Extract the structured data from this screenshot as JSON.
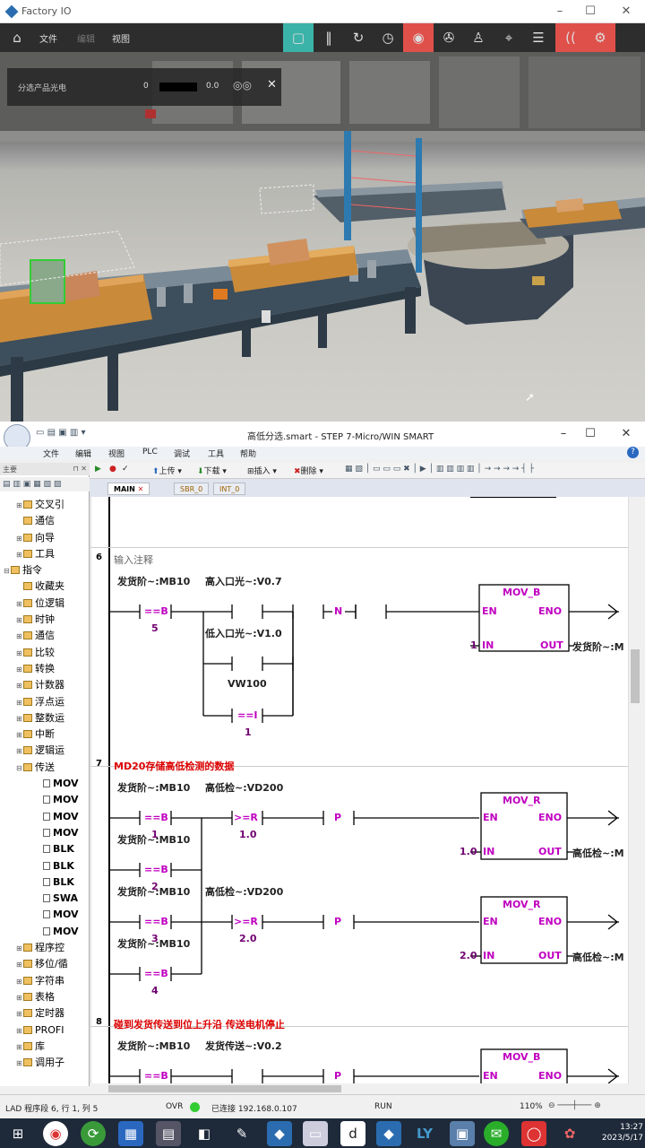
{
  "factoryio": {
    "title": "Factory IO",
    "menu": [
      "文件",
      "编辑",
      "视图"
    ],
    "sensor_panel": {
      "label": "分选产品光电",
      "value_left": "0",
      "value_right": "0.0"
    }
  },
  "step7": {
    "title": "高低分选.smart - STEP 7-Micro/WIN SMART",
    "menu": [
      "文件",
      "编辑",
      "视图",
      "PLC",
      "调试",
      "工具",
      "帮助"
    ],
    "toolbar": {
      "upload": "上传",
      "download": "下载",
      "insert": "插入",
      "delete": "删除"
    },
    "tabs": [
      "MAIN",
      "SBR_0",
      "INT_0"
    ],
    "side_header": "主要",
    "tree": [
      {
        "label": "交叉引",
        "expand": "⊞"
      },
      {
        "label": "通信",
        "expand": ""
      },
      {
        "label": "向导",
        "expand": "⊞"
      },
      {
        "label": "工具",
        "expand": "⊞"
      },
      {
        "label": "指令",
        "expand": "⊟"
      },
      {
        "label": "收藏夹",
        "expand": ""
      },
      {
        "label": "位逻辑",
        "expand": "⊞"
      },
      {
        "label": "时钟",
        "expand": "⊞"
      },
      {
        "label": "通信",
        "expand": "⊞"
      },
      {
        "label": "比较",
        "expand": "⊞"
      },
      {
        "label": "转换",
        "expand": "⊞"
      },
      {
        "label": "计数器",
        "expand": "⊞"
      },
      {
        "label": "浮点运",
        "expand": "⊞"
      },
      {
        "label": "整数运",
        "expand": "⊞"
      },
      {
        "label": "中断",
        "expand": "⊞"
      },
      {
        "label": "逻辑运",
        "expand": "⊞"
      },
      {
        "label": "传送",
        "expand": "⊟"
      },
      {
        "label": "MOV",
        "expand": "leaf"
      },
      {
        "label": "MOV",
        "expand": "leaf"
      },
      {
        "label": "MOV",
        "expand": "leaf"
      },
      {
        "label": "MOV",
        "expand": "leaf"
      },
      {
        "label": "BLK",
        "expand": "leaf"
      },
      {
        "label": "BLK",
        "expand": "leaf"
      },
      {
        "label": "BLK",
        "expand": "leaf"
      },
      {
        "label": "SWA",
        "expand": "leaf"
      },
      {
        "label": "MOV",
        "expand": "leaf"
      },
      {
        "label": "MOV",
        "expand": "leaf"
      },
      {
        "label": "程序控",
        "expand": "⊞"
      },
      {
        "label": "移位/循",
        "expand": "⊞"
      },
      {
        "label": "字符串",
        "expand": "⊞"
      },
      {
        "label": "表格",
        "expand": "⊞"
      },
      {
        "label": "定时器",
        "expand": "⊞"
      },
      {
        "label": "PROFI",
        "expand": "⊞"
      },
      {
        "label": "库",
        "expand": "⊞"
      },
      {
        "label": "调用子",
        "expand": "⊞"
      }
    ],
    "networks": {
      "n6": {
        "no": "6",
        "comment": "输入注释",
        "c1": "发货阶~:MB10",
        "c1_op": "==B",
        "c1_val": "5",
        "c2": "高入口光~:V0.7",
        "c3": "低入口光~:V1.0",
        "c4": "VW100",
        "c4_op": "==I",
        "c4_val": "1",
        "edge": "N",
        "box": "MOV_B",
        "in_val": "1",
        "out": "发货阶~:M"
      },
      "n7": {
        "no": "7",
        "comment": "MD20存储高低检测的数据",
        "r1a": "发货阶~:MB10",
        "r1a_op": "==B",
        "r1a_val": "1",
        "r1b": "高低检~:VD200",
        "r1b_op": ">=R",
        "r1b_val": "1.0",
        "r2a": "发货阶~:MB10",
        "r2a_op": "==B",
        "r2a_val": "2",
        "r3a": "发货阶~:MB10",
        "r3a_op": "==B",
        "r3a_val": "3",
        "r3b": "高低检~:VD200",
        "r3b_op": ">=R",
        "r3b_val": "2.0",
        "r4a": "发货阶~:MB10",
        "r4a_op": "==B",
        "r4a_val": "4",
        "edge": "P",
        "box1": "MOV_R",
        "box1_in": "1.0",
        "box1_out": "高低检~:M",
        "box2": "MOV_R",
        "box2_in": "2.0",
        "box2_out": "高低检~:M"
      },
      "n8": {
        "no": "8",
        "comment": "碰到发货传送到位上升沿    传送电机停止",
        "c1": "发货阶~:MB10",
        "c1_op": "==B",
        "c2": "发货传送~:V0.2",
        "edge": "P",
        "box": "MOV_B"
      }
    },
    "pins": {
      "en": "EN",
      "eno": "ENO",
      "in": "IN",
      "out": "OUT"
    },
    "status": {
      "pos": "LAD 程序段 6, 行 1, 列 5",
      "mode": "OVR",
      "conn": "已连接 192.168.0.107",
      "run": "RUN",
      "zoom": "110%"
    }
  },
  "taskbar": {
    "time": "13:27",
    "date": "2023/5/17"
  }
}
